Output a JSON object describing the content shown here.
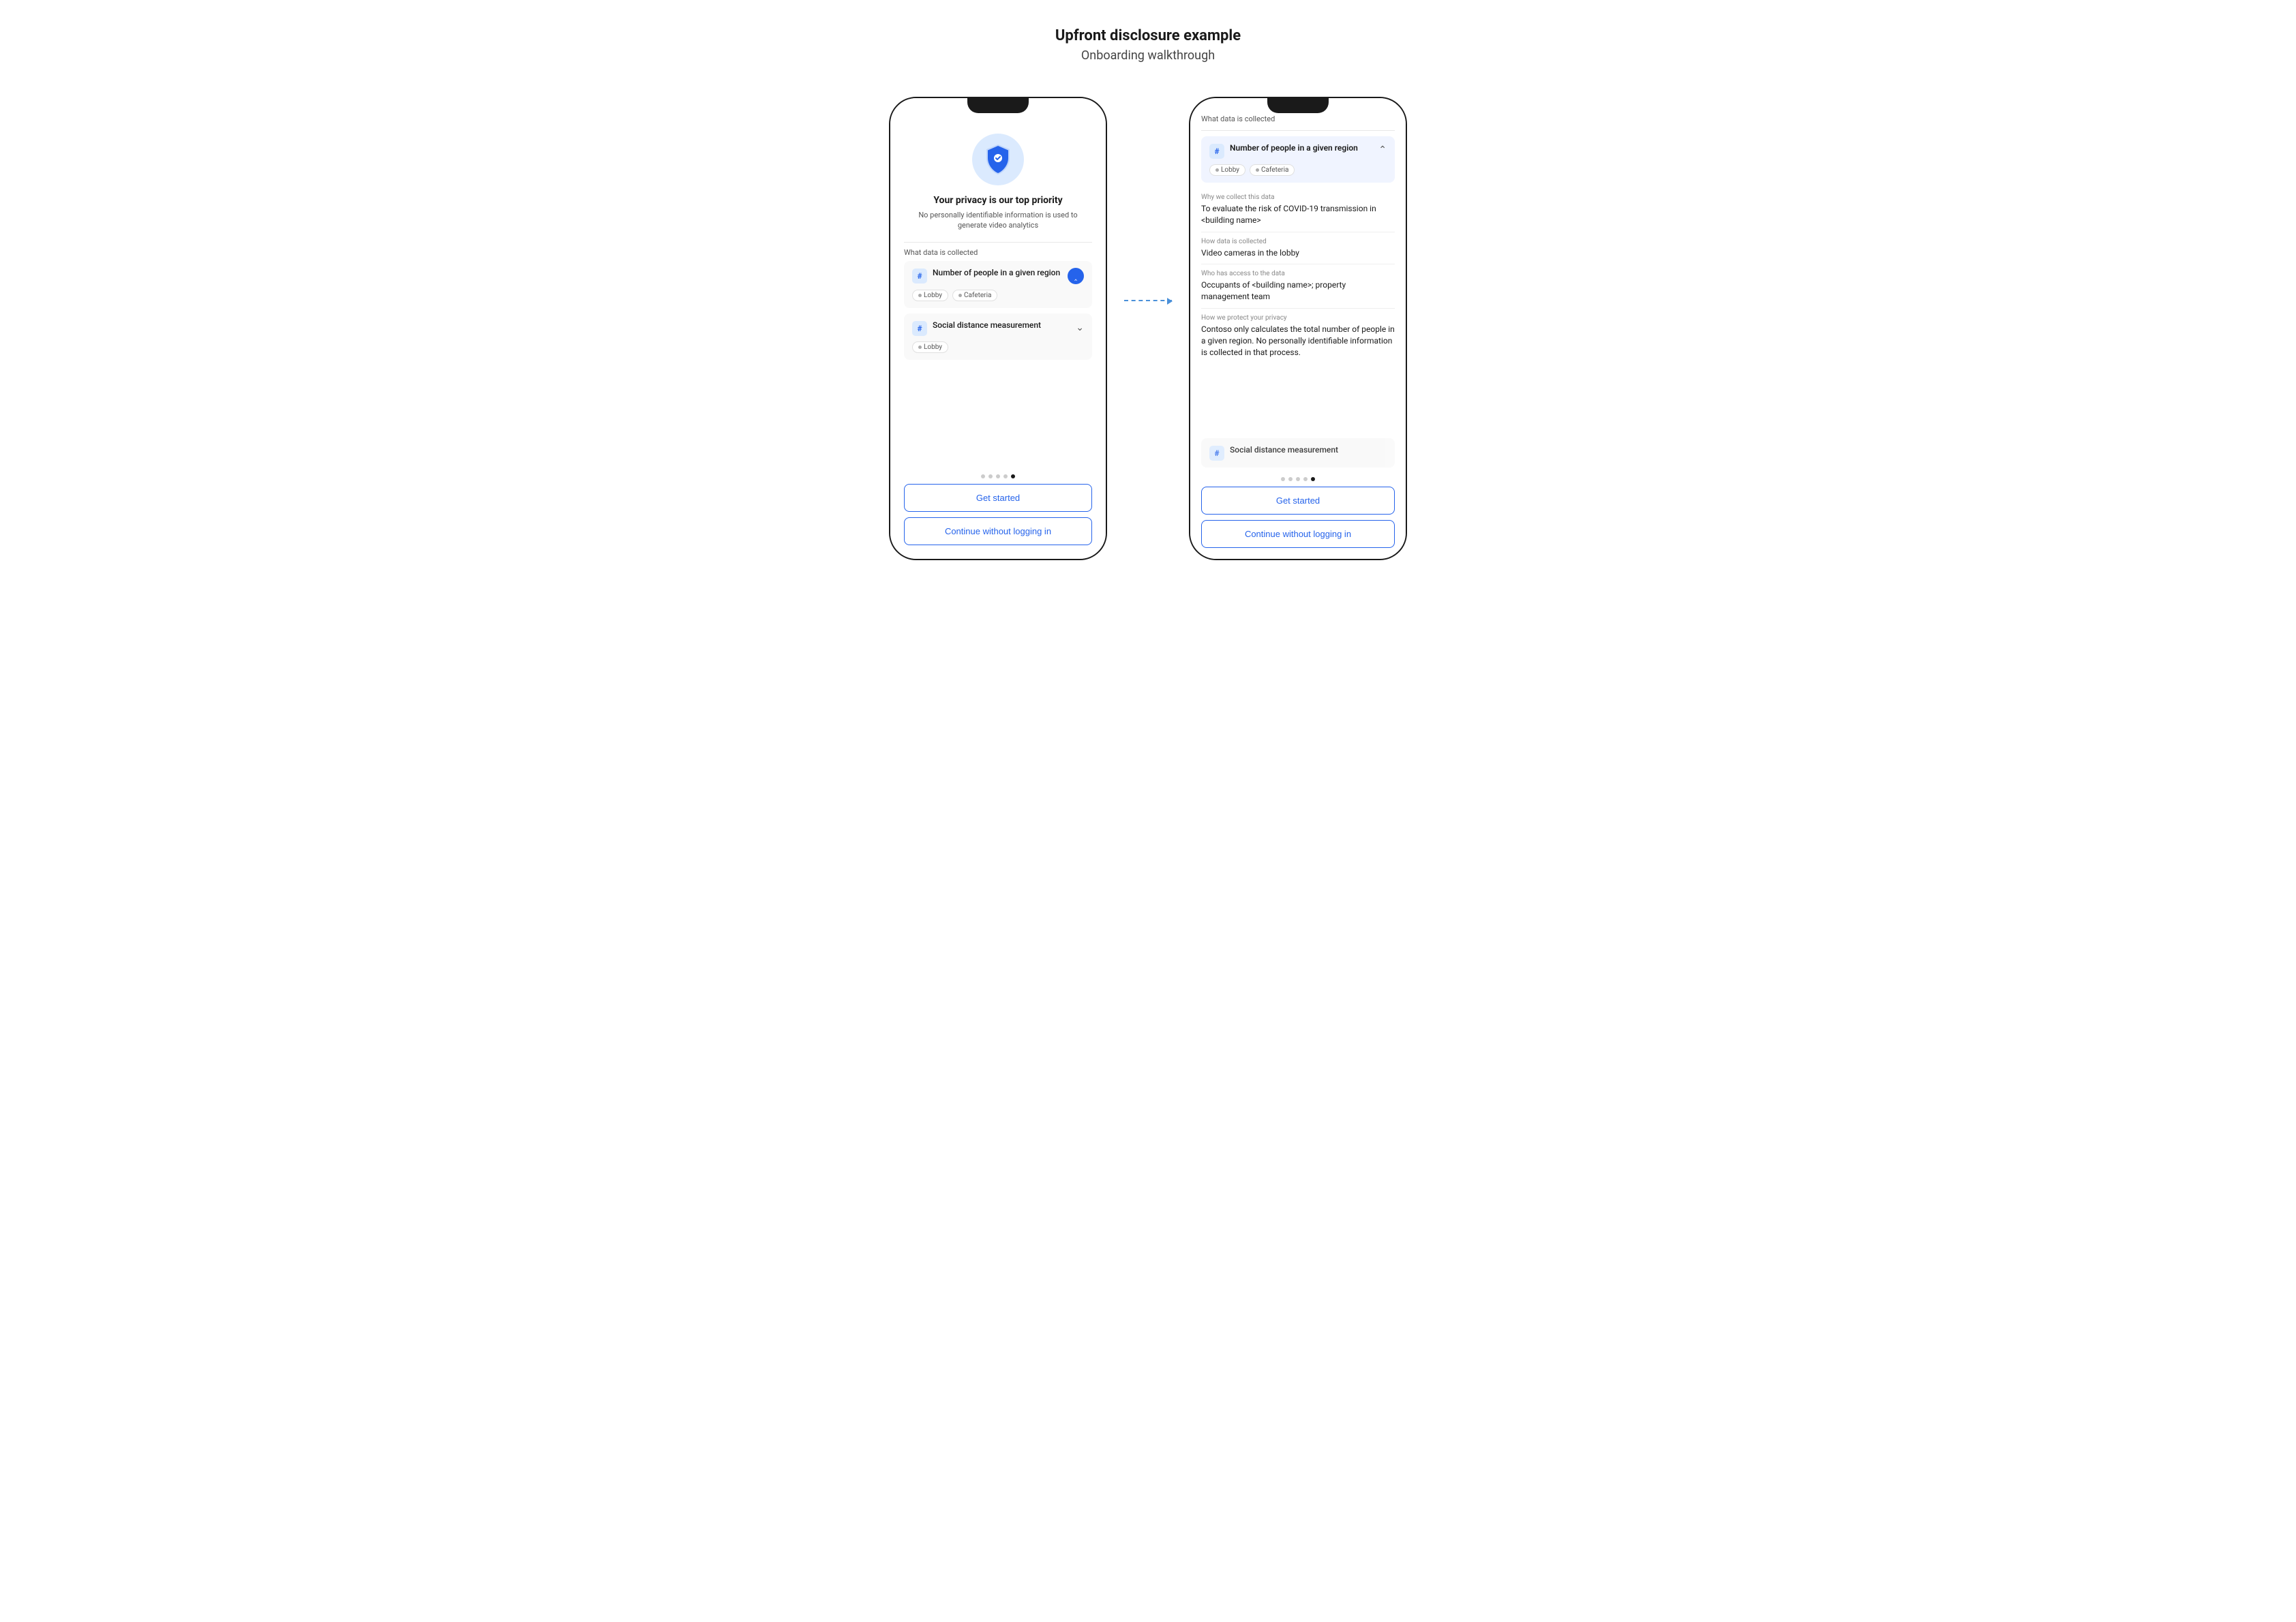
{
  "header": {
    "title": "Upfront disclosure example",
    "subtitle": "Onboarding walkthrough"
  },
  "phone1": {
    "hero": {
      "title": "Your privacy is our top priority",
      "subtitle": "No personally identifiable information is used to generate video analytics"
    },
    "section_label": "What data is collected",
    "items": [
      {
        "title": "Number of people in a given region",
        "tags": [
          "Lobby",
          "Cafeteria"
        ],
        "expanded": true
      },
      {
        "title": "Social distance measurement",
        "tags": [
          "Lobby"
        ],
        "expanded": false
      }
    ],
    "dots": [
      false,
      false,
      false,
      false,
      true
    ],
    "btn_primary": "Get started",
    "btn_secondary": "Continue without logging in"
  },
  "phone2": {
    "header_label": "What data is collected",
    "expanded_item": {
      "title": "Number of people in a given region",
      "tags": [
        "Lobby",
        "Cafeteria"
      ]
    },
    "detail_sections": [
      {
        "label": "Why we collect this data",
        "value": "To evaluate the risk of COVID-19 transmission in <building name>"
      },
      {
        "label": "How data is collected",
        "value": "Video cameras in the lobby"
      },
      {
        "label": "Who has access to the data",
        "value": "Occupants of <building name>; property management team"
      },
      {
        "label": "How we protect your privacy",
        "value": "Contoso only calculates the total number of people in a given region. No personally identifiable information is collected in that process."
      }
    ],
    "partial_item": "Social distance measurement",
    "dots": [
      false,
      false,
      false,
      false,
      true
    ],
    "btn_primary": "Get started",
    "btn_secondary": "Continue without logging in"
  },
  "arrow": {
    "label": "arrow-connector"
  }
}
